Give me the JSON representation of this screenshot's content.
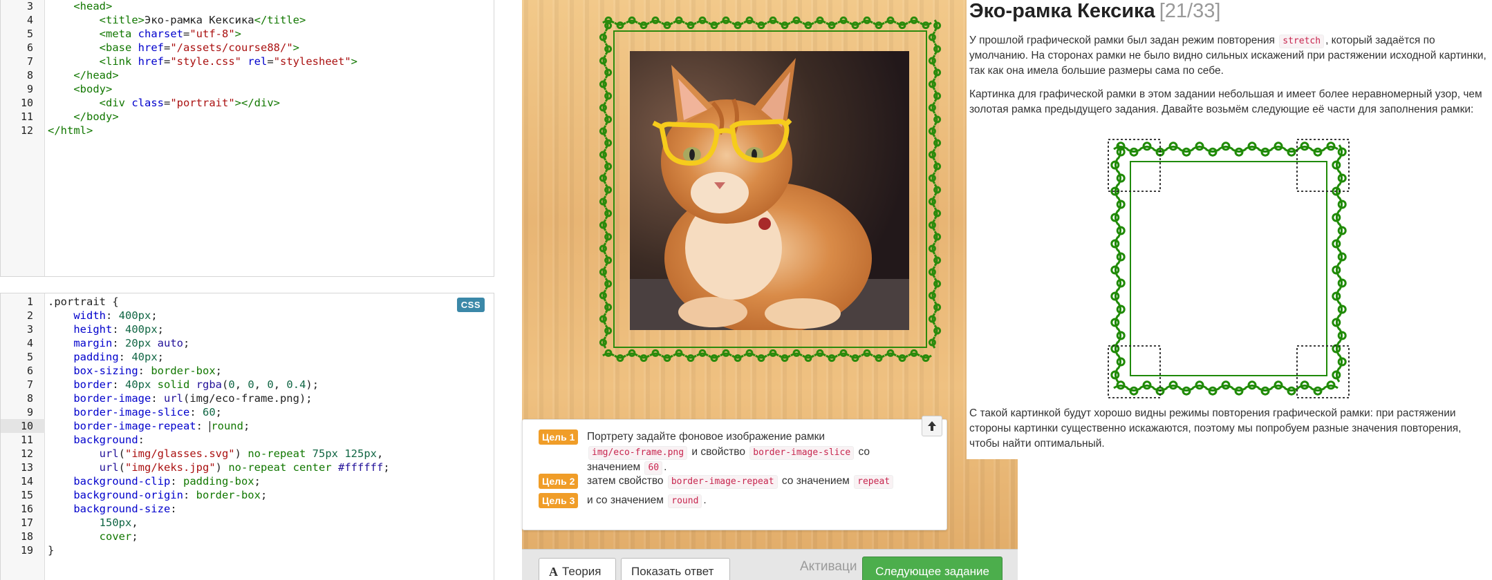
{
  "html_editor": {
    "lines": [
      {
        "n": "3",
        "html": "    <span class='t-tag'>&lt;head&gt;</span>"
      },
      {
        "n": "4",
        "html": "        <span class='t-tag'>&lt;title&gt;</span>Эко-рамка Кексика<span class='t-tag'>&lt;/title&gt;</span>"
      },
      {
        "n": "5",
        "html": "        <span class='t-tag'>&lt;meta</span> <span class='t-attr'>charset</span>=<span class='t-str'>\"utf-8\"</span><span class='t-tag'>&gt;</span>"
      },
      {
        "n": "6",
        "html": "        <span class='t-tag'>&lt;base</span> <span class='t-attr'>href</span>=<span class='t-str'>\"/assets/course88/\"</span><span class='t-tag'>&gt;</span>"
      },
      {
        "n": "7",
        "html": "        <span class='t-tag'>&lt;link</span> <span class='t-attr'>href</span>=<span class='t-str'>\"style.css\"</span> <span class='t-attr'>rel</span>=<span class='t-str'>\"stylesheet\"</span><span class='t-tag'>&gt;</span>"
      },
      {
        "n": "8",
        "html": "    <span class='t-tag'>&lt;/head&gt;</span>"
      },
      {
        "n": "9",
        "html": "    <span class='t-tag'>&lt;body&gt;</span>"
      },
      {
        "n": "10",
        "html": "        <span class='t-tag'>&lt;div</span> <span class='t-attr'>class</span>=<span class='t-str'>\"portrait\"</span><span class='t-tag'>&gt;&lt;/div&gt;</span>"
      },
      {
        "n": "11",
        "html": "    <span class='t-tag'>&lt;/body&gt;</span>"
      },
      {
        "n": "12",
        "html": "<span class='t-tag'>&lt;/html&gt;</span>"
      }
    ]
  },
  "css_editor": {
    "badge": "CSS",
    "active_line": "10",
    "lines": [
      {
        "n": "1",
        "html": ".portrait {"
      },
      {
        "n": "2",
        "html": "    <span class='t-prop'>width</span>: <span class='t-num'>400px</span>;"
      },
      {
        "n": "3",
        "html": "    <span class='t-prop'>height</span>: <span class='t-num'>400px</span>;"
      },
      {
        "n": "4",
        "html": "    <span class='t-prop'>margin</span>: <span class='t-num'>20px</span> <span class='t-atom'>auto</span>;"
      },
      {
        "n": "5",
        "html": "    <span class='t-prop'>padding</span>: <span class='t-num'>40px</span>;"
      },
      {
        "n": "6",
        "html": "    <span class='t-prop'>box-sizing</span>: <span class='t-kw'>border-box</span>;"
      },
      {
        "n": "7",
        "html": "    <span class='t-prop'>border</span>: <span class='t-num'>40px</span> <span class='t-kw'>solid</span> <span class='t-atom'>rgba</span>(<span class='t-num'>0</span>, <span class='t-num'>0</span>, <span class='t-num'>0</span>, <span class='t-num'>0.4</span>);"
      },
      {
        "n": "8",
        "html": "    <span class='t-prop'>border-image</span>: <span class='t-atom'>url</span>(img/eco-frame.png);"
      },
      {
        "n": "9",
        "html": "    <span class='t-prop'>border-image-slice</span>: <span class='t-num'>60</span>;"
      },
      {
        "n": "10",
        "html": "    <span class='t-prop'>border-image-repeat</span>: <span class='caret'></span><span class='t-kw'>round</span>;"
      },
      {
        "n": "11",
        "html": "    <span class='t-prop'>background</span>:"
      },
      {
        "n": "12",
        "html": "        <span class='t-atom'>url</span>(<span class='t-str'>\"img/glasses.svg\"</span>) <span class='t-kw'>no-repeat</span> <span class='t-num'>75px</span> <span class='t-num'>125px</span>,"
      },
      {
        "n": "13",
        "html": "        <span class='t-atom'>url</span>(<span class='t-str'>\"img/keks.jpg\"</span>) <span class='t-kw'>no-repeat</span> <span class='t-kw'>center</span> <span class='t-atom'>#ffffff</span>;"
      },
      {
        "n": "14",
        "html": "    <span class='t-prop'>background-clip</span>: <span class='t-kw'>padding-box</span>;"
      },
      {
        "n": "15",
        "html": "    <span class='t-prop'>background-origin</span>: <span class='t-kw'>border-box</span>;"
      },
      {
        "n": "16",
        "html": "    <span class='t-prop'>background-size</span>:"
      },
      {
        "n": "17",
        "html": "        <span class='t-num'>150px</span>,"
      },
      {
        "n": "18",
        "html": "        <span class='t-kw'>cover</span>;"
      },
      {
        "n": "19",
        "html": "}"
      }
    ]
  },
  "tasks": [
    {
      "badge": "Цель 1",
      "parts": [
        "Портрету задайте фоновое изображение рамки ",
        {
          "code": "img/eco-frame.png"
        },
        " и свойство ",
        {
          "code": "border-image-slice"
        },
        " со значением ",
        {
          "code": "60"
        },
        "."
      ]
    },
    {
      "badge": "Цель 2",
      "parts": [
        "затем свойство ",
        {
          "code": "border-image-repeat"
        },
        " со значением ",
        {
          "code": "repeat"
        }
      ]
    },
    {
      "badge": "Цель 3",
      "parts": [
        "и со значением ",
        {
          "code": "round"
        },
        "."
      ]
    }
  ],
  "toolbar": {
    "theory_label": "Теория",
    "answer_label": "Показать ответ",
    "activation_text": "Активаци",
    "next_label": "Следующее задание"
  },
  "description": {
    "title": "Эко-рамка Кексика",
    "counter": "[21/33]",
    "p1_before": "У прошлой графической рамки был задан режим повторения ",
    "p1_code": "stretch",
    "p1_after": ", который задаётся по умолчанию. На сторонах рамки не было видно сильных искажений при растяжении исходной картинки, так как она имела большие размеры сама по себе.",
    "p2": "Картинка для графической рамки в этом задании небольшая и имеет более неравномерный узор, чем золотая рамка предыдущего задания. Давайте возьмём следующие её части для заполнения рамки:",
    "p3": "С такой картинкой будут хорошо видны режимы повторения графической рамки: при растяжении стороны картинки существенно искажаются, поэтому мы попробуем разные значения повторения, чтобы найти оптимальный."
  },
  "colors": {
    "accent_green": "#4cae4c",
    "task_badge": "#f09d28",
    "frame_green": "#2a8a0c",
    "css_badge": "#3b88a8"
  }
}
